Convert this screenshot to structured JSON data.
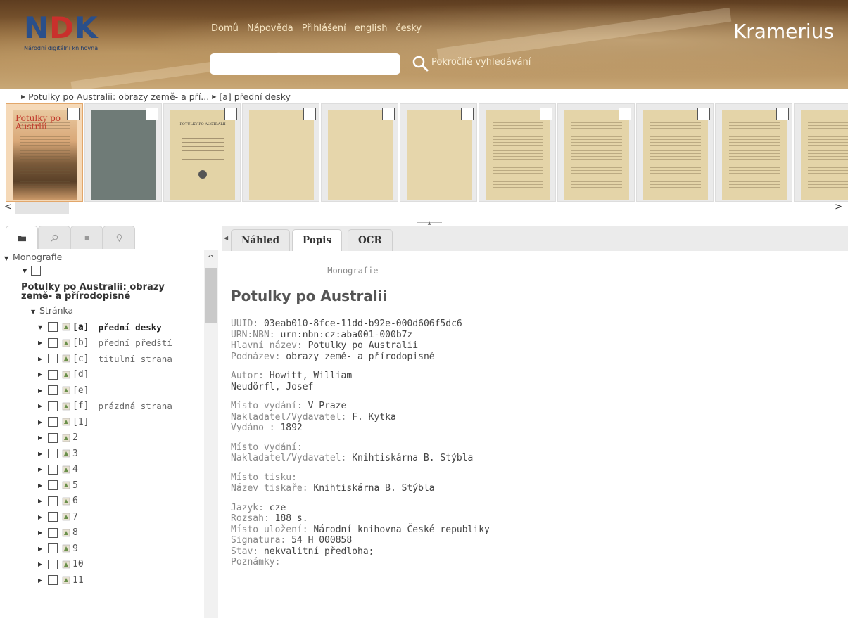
{
  "header": {
    "logo_text": "NDK",
    "logo_subtitle": "Národní digitální knihovna",
    "nav": [
      "Domů",
      "Nápověda",
      "Přihlášení",
      "english",
      "česky"
    ],
    "app_title": "Kramerius",
    "search": {
      "value": "",
      "placeholder": ""
    },
    "advanced_search": "Pokročilé vyhledávání"
  },
  "breadcrumb": [
    "Potulky po Australii: obrazy země- a pří...",
    "[a] přední desky"
  ],
  "thumbnails": [
    {
      "kind": "cover",
      "selected": true
    },
    {
      "kind": "grey"
    },
    {
      "kind": "title"
    },
    {
      "kind": "sparse"
    },
    {
      "kind": "sparse"
    },
    {
      "kind": "sparse"
    },
    {
      "kind": "text"
    },
    {
      "kind": "text"
    },
    {
      "kind": "text"
    },
    {
      "kind": "text"
    },
    {
      "kind": "text"
    }
  ],
  "thumb_cover_text": "Potulky po Austrlii",
  "thumb_title_text": "POTULKY PO AUSTRALII",
  "left_tabs": [
    {
      "icon": "folder-icon",
      "active": true
    },
    {
      "icon": "search-icon",
      "active": false
    },
    {
      "icon": "square-icon",
      "active": false
    },
    {
      "icon": "location-pin-icon",
      "active": false
    }
  ],
  "tree": {
    "root_label": "Monografie",
    "title": "Potulky po Australii: obrazy země- a přírodopisné",
    "sub_label": "Stránka",
    "items": [
      {
        "name": "[a]",
        "desc": "přední desky",
        "selected": true,
        "expanded": true
      },
      {
        "name": "[b]",
        "desc": "přední předští"
      },
      {
        "name": "[c]",
        "desc": "titulní strana"
      },
      {
        "name": "[d]",
        "desc": ""
      },
      {
        "name": "[e]",
        "desc": ""
      },
      {
        "name": "[f]",
        "desc": "prázdná strana"
      },
      {
        "name": "[1]",
        "desc": ""
      },
      {
        "name": "2",
        "desc": ""
      },
      {
        "name": "3",
        "desc": ""
      },
      {
        "name": "4",
        "desc": ""
      },
      {
        "name": "5",
        "desc": ""
      },
      {
        "name": "6",
        "desc": ""
      },
      {
        "name": "7",
        "desc": ""
      },
      {
        "name": "8",
        "desc": ""
      },
      {
        "name": "9",
        "desc": ""
      },
      {
        "name": "10",
        "desc": ""
      },
      {
        "name": "11",
        "desc": ""
      }
    ]
  },
  "content_tabs": [
    {
      "label": "Náhled",
      "active": false
    },
    {
      "label": "Popis",
      "active": true
    },
    {
      "label": "OCR",
      "active": false
    }
  ],
  "description": {
    "separator": "-------------------Monografie-------------------",
    "title": "Potulky po Australii",
    "groups": [
      [
        {
          "label": "UUID: ",
          "value": "03eab010-8fce-11dd-b92e-000d606f5dc6"
        },
        {
          "label": "URN:NBN: ",
          "value": "urn:nbn:cz:aba001-000b7z"
        },
        {
          "label": "Hlavní název: ",
          "value": "Potulky po Australii"
        },
        {
          "label": "Podnázev: ",
          "value": "obrazy země- a přírodopisné"
        }
      ],
      [
        {
          "label": "Autor: ",
          "value": "Howitt, William"
        },
        {
          "label": "",
          "value": "Neudörfl, Josef"
        }
      ],
      [
        {
          "label": "Místo vydání: ",
          "value": "V Praze"
        },
        {
          "label": "Nakladatel/Vydavatel: ",
          "value": "F. Kytka"
        },
        {
          "label": "Vydáno : ",
          "value": "1892"
        }
      ],
      [
        {
          "label": "Místo vydání:",
          "value": ""
        },
        {
          "label": "Nakladatel/Vydavatel: ",
          "value": "Knihtiskárna B. Stýbla"
        }
      ],
      [
        {
          "label": "Místo tisku:",
          "value": ""
        },
        {
          "label": "Název tiskaře: ",
          "value": "Knihtiskárna B. Stýbla"
        }
      ],
      [
        {
          "label": "Jazyk: ",
          "value": "cze"
        },
        {
          "label": "Rozsah: ",
          "value": "188 s."
        },
        {
          "label": "Místo uložení: ",
          "value": "Národní knihovna České republiky"
        },
        {
          "label": "Signatura: ",
          "value": "54 H 000858"
        },
        {
          "label": "Stav: ",
          "value": "nekvalitní předloha;"
        },
        {
          "label": "Poznámky:",
          "value": ""
        }
      ]
    ]
  },
  "colors": {
    "header_brown": "#8b6438",
    "logo_blue": "#2a4f8a",
    "logo_red": "#c9302c",
    "selected_thumb": "#f5d9b8"
  }
}
